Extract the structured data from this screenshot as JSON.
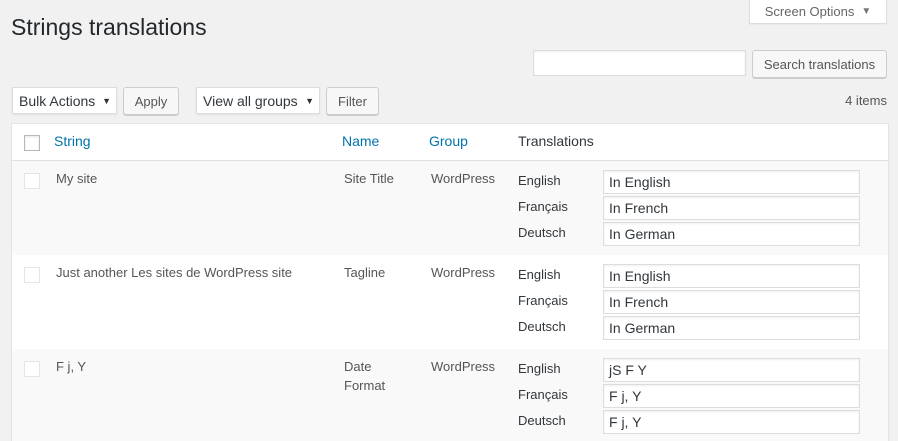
{
  "screen_options": {
    "label": "Screen Options",
    "caret_icon": "triangle-down-icon"
  },
  "page_title": "Strings translations",
  "search": {
    "value": "",
    "button_label": "Search translations"
  },
  "toolbar": {
    "bulk_actions": "Bulk Actions",
    "apply_label": "Apply",
    "group_filter": "View all groups",
    "filter_label": "Filter",
    "items_count": "4 items"
  },
  "table": {
    "headers": {
      "string": "String",
      "name": "Name",
      "group": "Group",
      "translations": "Translations"
    },
    "rows": [
      {
        "string": "My site",
        "name": "Site Title",
        "group": "WordPress",
        "translations": [
          {
            "lang": "English",
            "value": "In English"
          },
          {
            "lang": "Français",
            "value": "In French"
          },
          {
            "lang": "Deutsch",
            "value": "In German"
          }
        ]
      },
      {
        "string": "Just another Les sites de WordPress site",
        "name": "Tagline",
        "group": "WordPress",
        "translations": [
          {
            "lang": "English",
            "value": "In English"
          },
          {
            "lang": "Français",
            "value": "In French"
          },
          {
            "lang": "Deutsch",
            "value": "In German"
          }
        ]
      },
      {
        "string": "F j, Y",
        "name": "Date Format",
        "group": "WordPress",
        "translations": [
          {
            "lang": "English",
            "value": "jS F Y"
          },
          {
            "lang": "Français",
            "value": "F j, Y"
          },
          {
            "lang": "Deutsch",
            "value": "F j, Y"
          }
        ]
      }
    ]
  }
}
